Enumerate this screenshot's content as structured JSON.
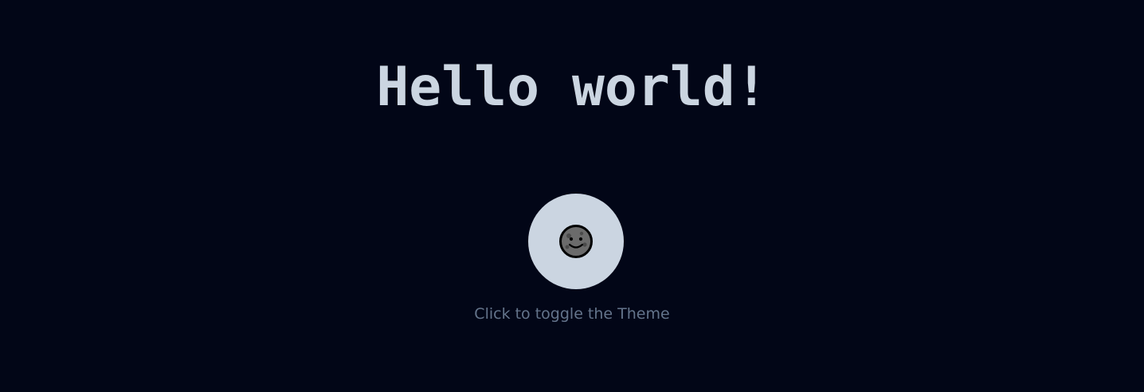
{
  "page": {
    "heading": "Hello world!",
    "caption": "Click to toggle the Theme"
  },
  "theme_toggle": {
    "icon": "new-moon-face-icon"
  },
  "colors": {
    "background": "#020617",
    "heading": "#cbd5e1",
    "button": "#cbd5e1",
    "caption": "#64748b",
    "moon_fill": "#6b6b6b",
    "moon_outline": "#000000"
  }
}
